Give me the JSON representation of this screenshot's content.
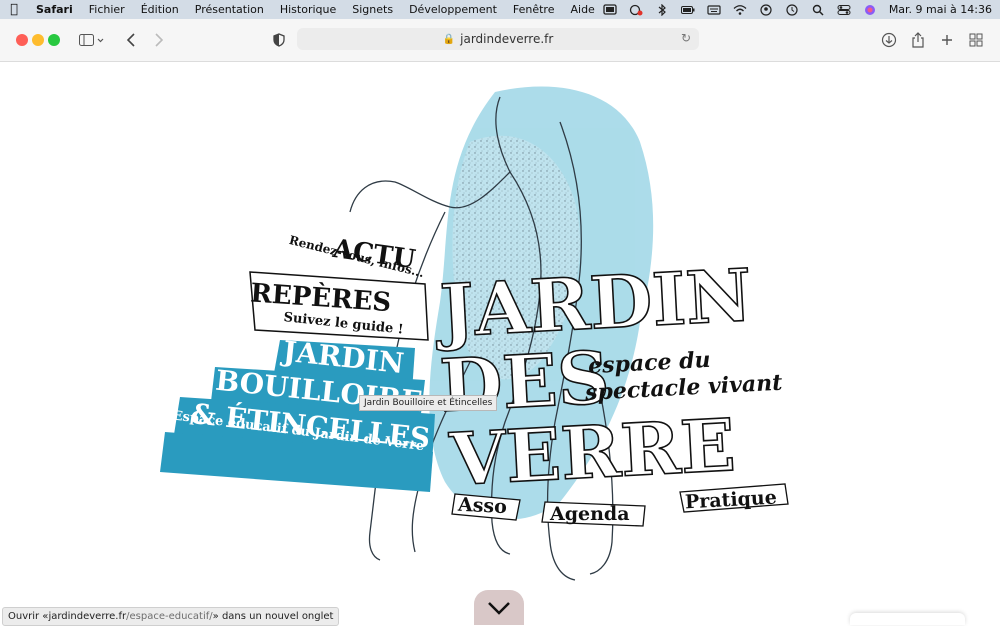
{
  "menubar": {
    "app": "Safari",
    "items": [
      "Fichier",
      "Édition",
      "Présentation",
      "Historique",
      "Signets",
      "Développement",
      "Fenêtre",
      "Aide"
    ],
    "clock": "Mar. 9 mai à 14:36"
  },
  "browser": {
    "url": "jardindeverre.fr"
  },
  "site": {
    "logo": {
      "line1": "JARDIN",
      "line2": "DES",
      "line3": "VERRE"
    },
    "tagline": {
      "line1": "espace du",
      "line2": "spectacle vivant"
    },
    "nav": {
      "actu": {
        "title": "ACTU",
        "subtitle": "Rendez-vous, infos..."
      },
      "reperes": {
        "title": "REPÈRES",
        "subtitle": "Suivez le guide !"
      },
      "educatif": {
        "line1": "JARDIN",
        "line2": "BOUILLOIRE",
        "line3": "& ÉTINCELLES",
        "subtitle": "Espace éducatif du Jardin de Verre"
      },
      "asso": "Asso",
      "agenda": "Agenda",
      "pratique": "Pratique"
    },
    "tooltip": "Jardin Bouilloire et Étincelles"
  },
  "statusbar": {
    "prefix": "Ouvrir « ",
    "domain": "jardindeverre.fr",
    "path": "/espace-educatif/",
    "suffix": " » dans un nouvel onglet"
  },
  "colors": {
    "teal": "#2a9bbf",
    "watercolor": "#9dd6e6"
  }
}
